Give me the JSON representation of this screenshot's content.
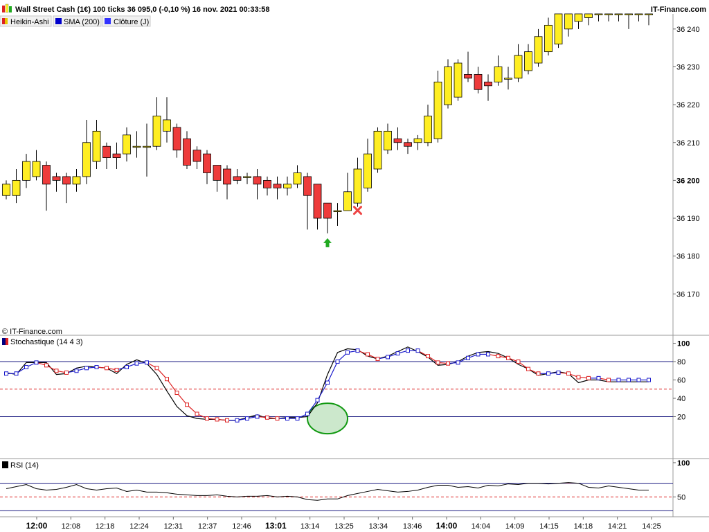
{
  "header": {
    "title": "Wall Street Cash (1€) 100 ticks 36 095,0 (-0,10 %) 16 nov. 2021 00:33:58",
    "brand": "IT-Finance.com",
    "copyright": "© IT-Finance.com"
  },
  "legend": [
    {
      "label": "Heikin-Ashi",
      "color": "#e8c800"
    },
    {
      "label": "SMA (200)",
      "color": "#0000cc"
    },
    {
      "label": "Clôture (J)",
      "color": "#3333ff"
    }
  ],
  "colors": {
    "bull": "#ffee22",
    "bear": "#ee3b3b",
    "stoch_k": "#000000",
    "stoch_d_up": "#1a1acc",
    "stoch_d_down": "#dd2222",
    "rsi_line": "#000000",
    "level_line": "#1a1a80",
    "dashed_line": "#dd2222",
    "signal_arrow": "#22aa22",
    "signal_cross": "#ee4444",
    "ellipse_fill": "#cce8cc",
    "ellipse_stroke": "#119911"
  },
  "icons": {
    "buy_signal": "green-up-arrow",
    "sell_signal": "red-cross"
  },
  "x_axis": {
    "labels": [
      "12:00",
      "12:08",
      "12:18",
      "12:24",
      "12:31",
      "12:37",
      "12:46",
      "13:01",
      "13:14",
      "13:25",
      "13:34",
      "13:46",
      "14:00",
      "14:04",
      "14:09",
      "14:15",
      "14:18",
      "14:21",
      "14:25"
    ],
    "bold": [
      "12:00",
      "13:01",
      "14:00"
    ]
  },
  "chart_data": [
    {
      "type": "candlestick",
      "name": "Heikin-Ashi",
      "y_ticks": [
        36170,
        36180,
        36190,
        36200,
        36210,
        36220,
        36230,
        36240
      ],
      "y_tick_labels": [
        "36 170",
        "36 180",
        "36 190",
        "36 200",
        "36 210",
        "36 220",
        "36 230",
        "36 240"
      ],
      "bold_ticks": [
        36200
      ],
      "ylim": [
        36162,
        36244
      ],
      "candles": [
        {
          "o": 36196,
          "c": 36199,
          "h": 36200,
          "l": 36195
        },
        {
          "o": 36196,
          "c": 36200,
          "h": 36203,
          "l": 36194
        },
        {
          "o": 36200,
          "c": 36205,
          "h": 36207,
          "l": 36198
        },
        {
          "o": 36201,
          "c": 36205,
          "h": 36208,
          "l": 36200
        },
        {
          "o": 36204,
          "c": 36199,
          "h": 36205,
          "l": 36192
        },
        {
          "o": 36201,
          "c": 36200,
          "h": 36202,
          "l": 36197
        },
        {
          "o": 36201,
          "c": 36199,
          "h": 36202,
          "l": 36194
        },
        {
          "o": 36199,
          "c": 36201,
          "h": 36203,
          "l": 36197
        },
        {
          "o": 36201,
          "c": 36210,
          "h": 36216,
          "l": 36199
        },
        {
          "o": 36205,
          "c": 36213,
          "h": 36216,
          "l": 36203
        },
        {
          "o": 36209,
          "c": 36206,
          "h": 36210,
          "l": 36203
        },
        {
          "o": 36207,
          "c": 36206,
          "h": 36210,
          "l": 36203
        },
        {
          "o": 36207,
          "c": 36212,
          "h": 36214,
          "l": 36205
        },
        {
          "o": 36209,
          "c": 36209,
          "h": 36213,
          "l": 36206
        },
        {
          "o": 36209,
          "c": 36209,
          "h": 36215,
          "l": 36201
        },
        {
          "o": 36209,
          "c": 36217,
          "h": 36222,
          "l": 36208
        },
        {
          "o": 36213,
          "c": 36216,
          "h": 36222,
          "l": 36210
        },
        {
          "o": 36214,
          "c": 36208,
          "h": 36215,
          "l": 36206
        },
        {
          "o": 36211,
          "c": 36204,
          "h": 36213,
          "l": 36203
        },
        {
          "o": 36208,
          "c": 36205,
          "h": 36209,
          "l": 36203
        },
        {
          "o": 36207,
          "c": 36202,
          "h": 36208,
          "l": 36199
        },
        {
          "o": 36204,
          "c": 36200,
          "h": 36204,
          "l": 36197
        },
        {
          "o": 36203,
          "c": 36199,
          "h": 36204,
          "l": 36195
        },
        {
          "o": 36201,
          "c": 36200,
          "h": 36203,
          "l": 36199
        },
        {
          "o": 36201,
          "c": 36201,
          "h": 36202,
          "l": 36199
        },
        {
          "o": 36201,
          "c": 36199,
          "h": 36203,
          "l": 36195
        },
        {
          "o": 36200,
          "c": 36198,
          "h": 36201,
          "l": 36196
        },
        {
          "o": 36199,
          "c": 36198,
          "h": 36201,
          "l": 36195
        },
        {
          "o": 36198,
          "c": 36199,
          "h": 36201,
          "l": 36196
        },
        {
          "o": 36199,
          "c": 36202,
          "h": 36204,
          "l": 36198
        },
        {
          "o": 36201,
          "c": 36196,
          "h": 36202,
          "l": 36187
        },
        {
          "o": 36199,
          "c": 36190,
          "h": 36199,
          "l": 36187
        },
        {
          "o": 36194,
          "c": 36190,
          "h": 36194,
          "l": 36186
        },
        {
          "o": 36192,
          "c": 36192,
          "h": 36194,
          "l": 36188
        },
        {
          "o": 36192,
          "c": 36197,
          "h": 36202,
          "l": 36192
        },
        {
          "o": 36194,
          "c": 36203,
          "h": 36206,
          "l": 36193
        },
        {
          "o": 36198,
          "c": 36207,
          "h": 36211,
          "l": 36197
        },
        {
          "o": 36203,
          "c": 36213,
          "h": 36214,
          "l": 36202
        },
        {
          "o": 36208,
          "c": 36213,
          "h": 36215,
          "l": 36207
        },
        {
          "o": 36211,
          "c": 36210,
          "h": 36214,
          "l": 36208
        },
        {
          "o": 36210,
          "c": 36209,
          "h": 36211,
          "l": 36207
        },
        {
          "o": 36210,
          "c": 36211,
          "h": 36212,
          "l": 36208
        },
        {
          "o": 36210,
          "c": 36217,
          "h": 36220,
          "l": 36209
        },
        {
          "o": 36211,
          "c": 36226,
          "h": 36229,
          "l": 36210
        },
        {
          "o": 36220,
          "c": 36230,
          "h": 36232,
          "l": 36219
        },
        {
          "o": 36222,
          "c": 36231,
          "h": 36232,
          "l": 36221
        },
        {
          "o": 36228,
          "c": 36227,
          "h": 36234,
          "l": 36226
        },
        {
          "o": 36228,
          "c": 36224,
          "h": 36230,
          "l": 36223
        },
        {
          "o": 36226,
          "c": 36225,
          "h": 36228,
          "l": 36221
        },
        {
          "o": 36226,
          "c": 36230,
          "h": 36233,
          "l": 36225
        },
        {
          "o": 36227,
          "c": 36227,
          "h": 36230,
          "l": 36224
        },
        {
          "o": 36227,
          "c": 36233,
          "h": 36236,
          "l": 36226
        },
        {
          "o": 36229,
          "c": 36234,
          "h": 36236,
          "l": 36228
        },
        {
          "o": 36231,
          "c": 36238,
          "h": 36240,
          "l": 36230
        },
        {
          "o": 36234,
          "c": 36241,
          "h": 36243,
          "l": 36233
        },
        {
          "o": 36236,
          "c": 36244,
          "h": 36244,
          "l": 36235
        },
        {
          "o": 36240,
          "c": 36244,
          "h": 36244,
          "l": 36238
        },
        {
          "o": 36242,
          "c": 36244,
          "h": 36244,
          "l": 36240
        },
        {
          "o": 36243,
          "c": 36244,
          "h": 36244,
          "l": 36241
        },
        {
          "o": 36244,
          "c": 36244,
          "h": 36244,
          "l": 36242
        },
        {
          "o": 36244,
          "c": 36244,
          "h": 36244,
          "l": 36242
        },
        {
          "o": 36244,
          "c": 36244,
          "h": 36244,
          "l": 36242
        },
        {
          "o": 36244,
          "c": 36244,
          "h": 36244,
          "l": 36240
        },
        {
          "o": 36244,
          "c": 36244,
          "h": 36244,
          "l": 36242
        },
        {
          "o": 36244,
          "c": 36244,
          "h": 36244,
          "l": 36241
        }
      ],
      "signals": [
        {
          "type": "buy",
          "index": 32
        },
        {
          "type": "sell",
          "index": 35
        }
      ]
    },
    {
      "type": "line",
      "name": "Stochastique (14 4 3)",
      "y_ticks": [
        20,
        40,
        60,
        80,
        100
      ],
      "ylim": [
        -25,
        108
      ],
      "levels": [
        20,
        80
      ],
      "dashed_level": 50,
      "series": [
        {
          "name": "K",
          "values": [
            68,
            66,
            79,
            79,
            79,
            66,
            67,
            73,
            75,
            74,
            73,
            67,
            77,
            82,
            78,
            66,
            48,
            31,
            21,
            18,
            17,
            17,
            16,
            16,
            19,
            22,
            18,
            18,
            19,
            19,
            20,
            35,
            66,
            90,
            94,
            93,
            86,
            83,
            86,
            91,
            96,
            91,
            85,
            76,
            77,
            80,
            86,
            90,
            91,
            89,
            84,
            77,
            72,
            65,
            67,
            69,
            67,
            57,
            60,
            60,
            58,
            58,
            58,
            58,
            58
          ]
        },
        {
          "name": "D",
          "values": [
            67,
            67,
            74,
            79,
            76,
            70,
            68,
            70,
            73,
            74,
            73,
            71,
            74,
            78,
            79,
            73,
            61,
            46,
            33,
            23,
            18,
            17,
            16,
            16,
            18,
            20,
            19,
            18,
            18,
            18,
            23,
            38,
            57,
            80,
            90,
            92,
            88,
            83,
            85,
            89,
            92,
            92,
            86,
            79,
            78,
            79,
            84,
            88,
            88,
            86,
            84,
            80,
            72,
            67,
            67,
            68,
            67,
            63,
            62,
            62,
            60,
            60,
            60,
            60,
            60
          ]
        }
      ]
    },
    {
      "type": "line",
      "name": "RSI (14)",
      "y_ticks": [
        50,
        100
      ],
      "ylim": [
        22,
        105
      ],
      "levels": [
        30,
        70
      ],
      "dashed_level": 50,
      "series": [
        {
          "name": "RSI",
          "values": [
            62,
            65,
            68,
            62,
            60,
            61,
            64,
            68,
            62,
            60,
            62,
            63,
            58,
            60,
            57,
            57,
            56,
            54,
            53,
            52,
            52,
            53,
            51,
            50,
            51,
            51,
            52,
            50,
            51,
            50,
            46,
            45,
            47,
            47,
            52,
            55,
            58,
            61,
            59,
            57,
            58,
            60,
            64,
            67,
            67,
            64,
            65,
            63,
            67,
            66,
            69,
            68,
            70,
            70,
            69,
            70,
            71,
            70,
            64,
            63,
            66,
            64,
            62,
            60,
            60
          ]
        }
      ]
    }
  ]
}
